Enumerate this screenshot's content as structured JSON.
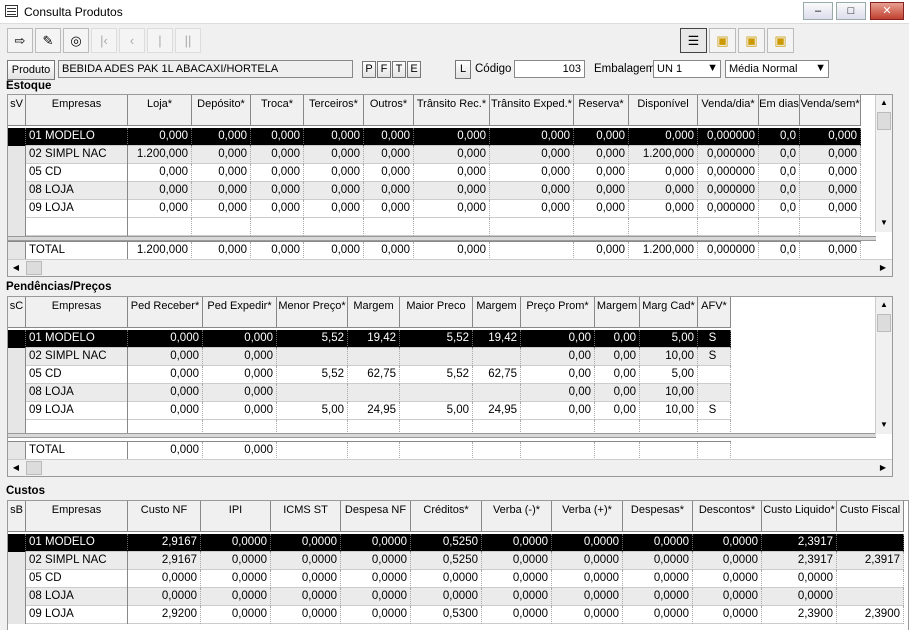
{
  "window": {
    "title": "Consulta Produtos"
  },
  "toolbar": {
    "icons": [
      "exit-icon",
      "eraser-icon",
      "binoculars-icon",
      "first-icon",
      "prev-icon",
      "next-icon",
      "last-icon"
    ],
    "view_icons": [
      "view-list-icon",
      "view-folder-icon",
      "view-folder2-icon",
      "view-folder3-icon"
    ]
  },
  "product": {
    "button": "Produto",
    "name": "BEBIDA ADES PAK 1L ABACAXI/HORTELA",
    "p_btn": "P",
    "f_btn": "F",
    "t_btn": "T",
    "e_btn": "E",
    "l_btn": "L",
    "codigo_label": "Código",
    "codigo_value": "103",
    "embalagem_label": "Embalagem",
    "embalagem_value": "UN  1",
    "media_value": "Média Normal"
  },
  "estoque": {
    "title": "Estoque",
    "headers": [
      "sV",
      "Empresas",
      "Loja*",
      "Depósito*",
      "Troca*",
      "Terceiros*",
      "Outros*",
      "Trânsito Rec.*",
      "Trânsito Exped.*",
      "Reserva*",
      "Disponível",
      "Venda/dia*",
      "Em dias",
      "Venda/sem*"
    ],
    "rows": [
      [
        "",
        "01 MODELO",
        "0,000",
        "0,000",
        "0,000",
        "0,000",
        "0,000",
        "0,000",
        "0,000",
        "0,000",
        "0,000",
        "0,000000",
        "0,0",
        "0,000"
      ],
      [
        "",
        "02 SIMPL NAC",
        "1.200,000",
        "0,000",
        "0,000",
        "0,000",
        "0,000",
        "0,000",
        "0,000",
        "0,000",
        "1.200,000",
        "0,000000",
        "0,0",
        "0,000"
      ],
      [
        "",
        "05 CD",
        "0,000",
        "0,000",
        "0,000",
        "0,000",
        "0,000",
        "0,000",
        "0,000",
        "0,000",
        "0,000",
        "0,000000",
        "0,0",
        "0,000"
      ],
      [
        "",
        "08 LOJA",
        "0,000",
        "0,000",
        "0,000",
        "0,000",
        "0,000",
        "0,000",
        "0,000",
        "0,000",
        "0,000",
        "0,000000",
        "0,0",
        "0,000"
      ],
      [
        "",
        "09 LOJA",
        "0,000",
        "0,000",
        "0,000",
        "0,000",
        "0,000",
        "0,000",
        "0,000",
        "0,000",
        "0,000",
        "0,000000",
        "0,0",
        "0,000"
      ]
    ],
    "total": [
      "",
      "TOTAL",
      "1.200,000",
      "0,000",
      "0,000",
      "0,000",
      "0,000",
      "0,000",
      "",
      "0,000",
      "1.200,000",
      "0,000000",
      "0,0",
      "0,000"
    ]
  },
  "pendencias": {
    "title": "Pendências/Preços",
    "headers": [
      "sC",
      "Empresas",
      "Ped Receber*",
      "Ped Expedir*",
      "Menor Preço*",
      "Margem",
      "Maior Preco",
      "Margem",
      "Preço Prom*",
      "Margem",
      "Marg Cad*",
      "AFV*"
    ],
    "rows": [
      [
        "",
        "01 MODELO",
        "0,000",
        "0,000",
        "5,52",
        "19,42",
        "5,52",
        "19,42",
        "0,00",
        "0,00",
        "5,00",
        "S"
      ],
      [
        "",
        "02 SIMPL NAC",
        "0,000",
        "0,000",
        "",
        "",
        "",
        "",
        "0,00",
        "0,00",
        "10,00",
        "S"
      ],
      [
        "",
        "05 CD",
        "0,000",
        "0,000",
        "5,52",
        "62,75",
        "5,52",
        "62,75",
        "0,00",
        "0,00",
        "5,00",
        ""
      ],
      [
        "",
        "08 LOJA",
        "0,000",
        "0,000",
        "",
        "",
        "",
        "",
        "0,00",
        "0,00",
        "10,00",
        ""
      ],
      [
        "",
        "09 LOJA",
        "0,000",
        "0,000",
        "5,00",
        "24,95",
        "5,00",
        "24,95",
        "0,00",
        "0,00",
        "10,00",
        "S"
      ]
    ],
    "total": [
      "",
      "TOTAL",
      "0,000",
      "0,000",
      "",
      "",
      "",
      "",
      "",
      "",
      "",
      ""
    ]
  },
  "custos": {
    "title": "Custos",
    "headers": [
      "sB",
      "Empresas",
      "Custo NF",
      "IPI",
      "ICMS ST",
      "Despesa NF",
      "Créditos*",
      "Verba (-)*",
      "Verba (+)*",
      "Despesas*",
      "Descontos*",
      "Custo Liquido*",
      "Custo Fiscal"
    ],
    "rows": [
      [
        "",
        "01 MODELO",
        "2,9167",
        "0,0000",
        "0,0000",
        "0,0000",
        "0,5250",
        "0,0000",
        "0,0000",
        "0,0000",
        "0,0000",
        "2,3917",
        ""
      ],
      [
        "",
        "02 SIMPL NAC",
        "2,9167",
        "0,0000",
        "0,0000",
        "0,0000",
        "0,5250",
        "0,0000",
        "0,0000",
        "0,0000",
        "0,0000",
        "2,3917",
        "2,3917"
      ],
      [
        "",
        "05 CD",
        "0,0000",
        "0,0000",
        "0,0000",
        "0,0000",
        "0,0000",
        "0,0000",
        "0,0000",
        "0,0000",
        "0,0000",
        "0,0000",
        ""
      ],
      [
        "",
        "08 LOJA",
        "0,0000",
        "0,0000",
        "0,0000",
        "0,0000",
        "0,0000",
        "0,0000",
        "0,0000",
        "0,0000",
        "0,0000",
        "0,0000",
        ""
      ],
      [
        "",
        "09 LOJA",
        "2,9200",
        "0,0000",
        "0,0000",
        "0,0000",
        "0,5300",
        "0,0000",
        "0,0000",
        "0,0000",
        "0,0000",
        "2,3900",
        "2,3900"
      ]
    ]
  }
}
